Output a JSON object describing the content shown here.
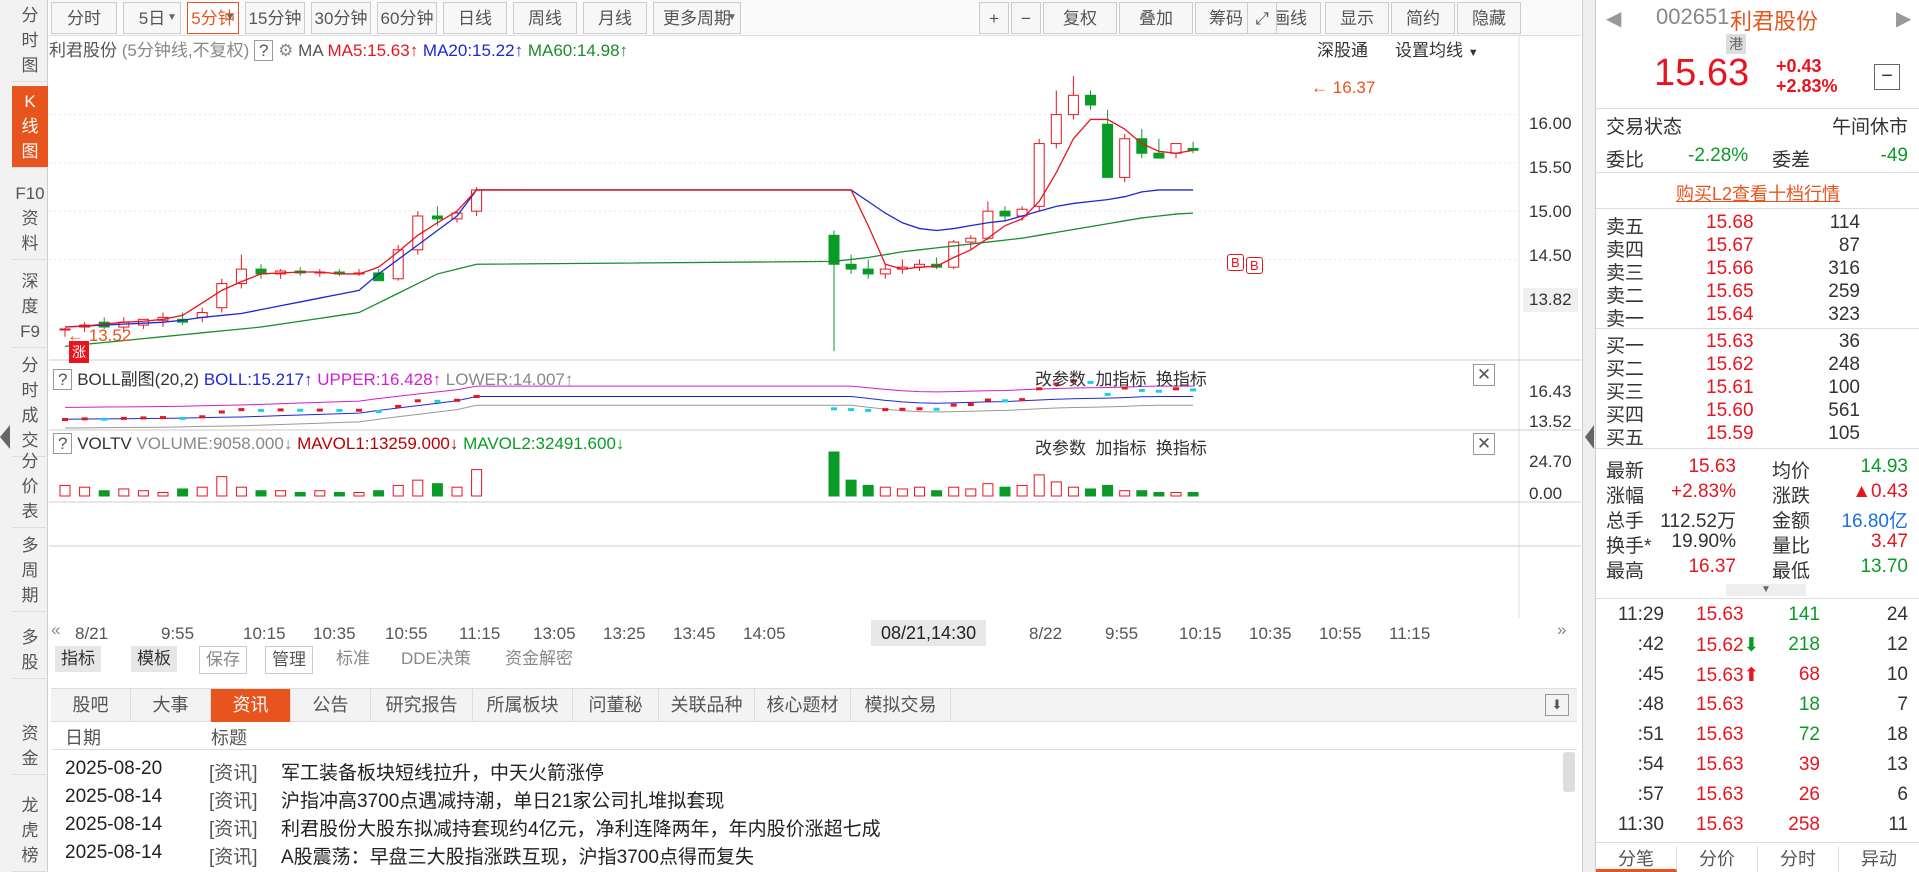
{
  "left_nav": [
    {
      "label": "分\n时\n图",
      "active": false
    },
    {
      "label": "K\n线\n图",
      "active": true
    },
    {
      "label": "F10\n资\n料",
      "active": false
    },
    {
      "label": "深\n度\nF9",
      "active": false
    },
    {
      "label": "分\n时\n成\n交",
      "active": false
    },
    {
      "label": "分\n价\n表",
      "active": false
    },
    {
      "label": "多\n周\n期",
      "active": false
    },
    {
      "label": "多\n股",
      "active": false
    },
    {
      "label": "资\n金",
      "active": false
    },
    {
      "label": "龙\n虎\n榜",
      "active": false
    }
  ],
  "toolbar": {
    "periods": [
      "分时",
      "5日",
      "5分钟",
      "15分钟",
      "30分钟",
      "60分钟",
      "日线",
      "周线",
      "月线",
      "更多周期"
    ],
    "active_period": "5分钟",
    "tools": [
      "+",
      "−",
      "复权",
      "叠加",
      "筹码",
      "画线",
      "显示",
      "简约",
      "隐藏"
    ]
  },
  "main_chart": {
    "name": "利君股份",
    "period_note": "(5分钟线,不复权)",
    "help": "?",
    "ma_label": "MA",
    "ma5": "MA5:15.63",
    "ma20": "MA20:15.22",
    "ma60": "MA60:14.98",
    "link1": "深股通",
    "link2": "设置均线",
    "high_label": "16.37",
    "low_label": "13.52",
    "limit_badge": "涨",
    "y_labels": [
      "16.00",
      "15.50",
      "15.00",
      "14.50"
    ],
    "cur_price": "13.82"
  },
  "boll": {
    "help": "?",
    "name": "BOLL副图(20,2)",
    "boll": "BOLL:15.217",
    "upper": "UPPER:16.428",
    "lower": "LOWER:14.007",
    "y_top": "16.43",
    "y_bot": "13.52",
    "btns": [
      "改参数",
      "加指标",
      "换指标"
    ]
  },
  "vol": {
    "help": "?",
    "name": "VOLTV",
    "volume": "VOLUME:9058.000",
    "mavol1": "MAVOL1:13259.000",
    "mavol2": "MAVOL2:32491.600",
    "y_top": "24.70",
    "y_bot": "0.00",
    "btns": [
      "改参数",
      "加指标",
      "换指标"
    ]
  },
  "x_axis": [
    "8/21",
    "9:55",
    "10:15",
    "10:35",
    "10:55",
    "11:15",
    "13:05",
    "13:25",
    "13:45",
    "14:05",
    "",
    "8/22",
    "9:55",
    "10:15",
    "10:35",
    "10:55",
    "11:15"
  ],
  "cursor_time": "08/21,14:30",
  "tool2": [
    "指标",
    "模板",
    "保存",
    "管理",
    "标准",
    "DDE决策",
    "资金解密"
  ],
  "bottom_tabs": [
    "股吧",
    "大事",
    "资讯",
    "公告",
    "研究报告",
    "所属板块",
    "问董秘",
    "关联品种",
    "核心题材",
    "模拟交易"
  ],
  "active_bottom_tab": "资讯",
  "news_header": {
    "date": "日期",
    "title": "标题"
  },
  "news": [
    {
      "date": "2025-08-20",
      "tag": "[资讯]",
      "title": "军工装备板块短线拉升，中天火箭涨停"
    },
    {
      "date": "2025-08-14",
      "tag": "[资讯]",
      "title": "沪指冲高3700点遇减持潮，单日21家公司扎堆拟套现"
    },
    {
      "date": "2025-08-14",
      "tag": "[资讯]",
      "title": "利君股份大股东拟减持套现约4亿元，净利连降两年，年内股价涨超七成"
    },
    {
      "date": "2025-08-14",
      "tag": "[资讯]",
      "title": "A股震荡：早盘三大股指涨跌互现，沪指3700点得而复失"
    }
  ],
  "quote": {
    "code": "002651",
    "name": "利君股份",
    "hk_badge": "港",
    "price": "15.63",
    "change": "+0.43",
    "pct": "+2.83%",
    "trade_status_label": "交易状态",
    "trade_status": "午间休市",
    "wb_label": "委比",
    "wb": "-2.28%",
    "wc_label": "委差",
    "wc": "-49",
    "l2_link": "购买L2查看十档行情",
    "sells": [
      {
        "l": "卖五",
        "p": "15.68",
        "v": "114"
      },
      {
        "l": "卖四",
        "p": "15.67",
        "v": "87"
      },
      {
        "l": "卖三",
        "p": "15.66",
        "v": "316"
      },
      {
        "l": "卖二",
        "p": "15.65",
        "v": "259"
      },
      {
        "l": "卖一",
        "p": "15.64",
        "v": "323"
      }
    ],
    "buys": [
      {
        "l": "买一",
        "p": "15.63",
        "v": "36"
      },
      {
        "l": "买二",
        "p": "15.62",
        "v": "248"
      },
      {
        "l": "买三",
        "p": "15.61",
        "v": "100"
      },
      {
        "l": "买四",
        "p": "15.60",
        "v": "561"
      },
      {
        "l": "买五",
        "p": "15.59",
        "v": "105"
      }
    ],
    "stats": [
      {
        "l1": "最新",
        "v1": "15.63",
        "c1": "red",
        "l2": "均价",
        "v2": "14.93",
        "c2": "green"
      },
      {
        "l1": "涨幅",
        "v1": "+2.83%",
        "c1": "red",
        "l2": "涨跌",
        "v2": "▲0.43",
        "c2": "red"
      },
      {
        "l1": "总手",
        "v1": "112.52万",
        "c1": "dark",
        "l2": "金额",
        "v2": "16.80亿",
        "c2": "blue"
      },
      {
        "l1": "换手*",
        "v1": "19.90%",
        "c1": "dark",
        "l2": "量比",
        "v2": "3.47",
        "c2": "red"
      },
      {
        "l1": "最高",
        "v1": "16.37",
        "c1": "red",
        "l2": "最低",
        "v2": "13.70",
        "c2": "green"
      }
    ],
    "ticks": [
      {
        "t": "11:29",
        "p": "15.63",
        "v": "141",
        "n": "24",
        "vc": "green",
        "arrow": ""
      },
      {
        "t": ":42",
        "p": "15.62",
        "v": "218",
        "n": "12",
        "vc": "green",
        "arrow": "down"
      },
      {
        "t": ":45",
        "p": "15.63",
        "v": "68",
        "n": "10",
        "vc": "red",
        "arrow": "up"
      },
      {
        "t": ":48",
        "p": "15.63",
        "v": "18",
        "n": "7",
        "vc": "green",
        "arrow": ""
      },
      {
        "t": ":51",
        "p": "15.63",
        "v": "72",
        "n": "18",
        "vc": "green",
        "arrow": ""
      },
      {
        "t": ":54",
        "p": "15.63",
        "v": "39",
        "n": "13",
        "vc": "red",
        "arrow": ""
      },
      {
        "t": ":57",
        "p": "15.63",
        "v": "26",
        "n": "6",
        "vc": "red",
        "arrow": ""
      },
      {
        "t": "11:30",
        "p": "15.63",
        "v": "258",
        "n": "11",
        "vc": "red",
        "arrow": ""
      }
    ],
    "bottom_tabs": [
      "分笔",
      "分价",
      "分时",
      "异动"
    ]
  },
  "colors": {
    "up": "#e8141e",
    "down": "#0a9b27",
    "accent": "#e8541e",
    "ma5": "#e8141e",
    "ma20": "#1e28d2",
    "ma60": "#1a8c2a"
  },
  "chart_data": {
    "type": "candlestick",
    "price_range": [
      13.5,
      16.4
    ],
    "candles": [
      [
        13.78,
        13.79,
        13.7,
        13.78
      ],
      [
        13.8,
        13.85,
        13.75,
        13.82
      ],
      [
        13.85,
        13.9,
        13.78,
        13.8
      ],
      [
        13.8,
        13.9,
        13.75,
        13.85
      ],
      [
        13.82,
        13.88,
        13.78,
        13.88
      ],
      [
        13.87,
        13.95,
        13.8,
        13.9
      ],
      [
        13.88,
        13.95,
        13.82,
        13.85
      ],
      [
        13.9,
        14.0,
        13.85,
        13.95
      ],
      [
        14.0,
        14.3,
        13.95,
        14.25
      ],
      [
        14.25,
        14.55,
        14.2,
        14.4
      ],
      [
        14.4,
        14.45,
        14.3,
        14.35
      ],
      [
        14.35,
        14.4,
        14.3,
        14.38
      ],
      [
        14.38,
        14.42,
        14.33,
        14.36
      ],
      [
        14.36,
        14.4,
        14.32,
        14.37
      ],
      [
        14.37,
        14.4,
        14.33,
        14.35
      ],
      [
        14.35,
        14.4,
        14.33,
        14.36
      ],
      [
        14.36,
        14.4,
        14.3,
        14.28
      ],
      [
        14.3,
        14.65,
        14.28,
        14.6
      ],
      [
        14.6,
        15.0,
        14.55,
        14.95
      ],
      [
        14.95,
        15.05,
        14.85,
        14.92
      ],
      [
        14.92,
        15.0,
        14.88,
        14.98
      ],
      [
        15.0,
        15.25,
        14.95,
        15.22
      ],
      [
        14.75,
        14.8,
        13.55,
        14.45
      ],
      [
        14.45,
        14.55,
        14.35,
        14.4
      ],
      [
        14.4,
        14.5,
        14.3,
        14.35
      ],
      [
        14.35,
        14.45,
        14.3,
        14.4
      ],
      [
        14.4,
        14.5,
        14.35,
        14.42
      ],
      [
        14.42,
        14.5,
        14.38,
        14.45
      ],
      [
        14.45,
        14.52,
        14.4,
        14.42
      ],
      [
        14.42,
        14.7,
        14.4,
        14.68
      ],
      [
        14.68,
        14.75,
        14.6,
        14.72
      ],
      [
        14.72,
        15.1,
        14.7,
        15.0
      ],
      [
        15.0,
        15.05,
        14.9,
        14.95
      ],
      [
        14.95,
        15.05,
        14.9,
        15.02
      ],
      [
        15.05,
        15.75,
        15.0,
        15.7
      ],
      [
        15.7,
        16.25,
        15.65,
        16.0
      ],
      [
        16.0,
        16.4,
        15.95,
        16.2
      ],
      [
        16.2,
        16.25,
        16.05,
        16.1
      ],
      [
        15.9,
        16.05,
        15.4,
        15.35
      ],
      [
        15.35,
        15.8,
        15.3,
        15.75
      ],
      [
        15.75,
        15.85,
        15.55,
        15.6
      ],
      [
        15.6,
        15.75,
        15.55,
        15.55
      ],
      [
        15.6,
        15.7,
        15.55,
        15.7
      ],
      [
        15.65,
        15.72,
        15.6,
        15.63
      ]
    ],
    "ma5": [
      13.8,
      13.81,
      13.83,
      13.85,
      13.86,
      13.88,
      13.92,
      14.05,
      14.18,
      14.27,
      14.35,
      14.36,
      14.37,
      14.37,
      14.35,
      14.35,
      14.42,
      14.58,
      14.75,
      14.88,
      15.0,
      15.22,
      15.22,
      15.22,
      14.85,
      14.45,
      14.4,
      14.42,
      14.43,
      14.52,
      14.6,
      14.72,
      14.85,
      14.92,
      15.1,
      15.4,
      15.75,
      15.95,
      15.95,
      15.85,
      15.7,
      15.62,
      15.6,
      15.63
    ],
    "ma20": [
      13.8,
      13.81,
      13.82,
      13.83,
      13.84,
      13.85,
      13.87,
      13.9,
      13.92,
      13.94,
      13.98,
      14.02,
      14.06,
      14.1,
      14.14,
      14.18,
      14.35,
      14.5,
      14.65,
      14.8,
      14.95,
      15.22,
      15.22,
      15.22,
      15.1,
      14.98,
      14.88,
      14.82,
      14.8,
      14.82,
      14.85,
      14.88,
      14.9,
      14.95,
      15.0,
      15.05,
      15.08,
      15.1,
      15.12,
      15.15,
      15.2,
      15.22,
      15.22,
      15.22
    ],
    "ma60": [
      13.6,
      13.62,
      13.64,
      13.66,
      13.68,
      13.7,
      13.72,
      13.74,
      13.76,
      13.78,
      13.8,
      13.83,
      13.86,
      13.89,
      13.92,
      13.95,
      14.05,
      14.15,
      14.25,
      14.35,
      14.4,
      14.45,
      14.48,
      14.5,
      14.52,
      14.55,
      14.58,
      14.6,
      14.62,
      14.64,
      14.66,
      14.68,
      14.7,
      14.72,
      14.75,
      14.78,
      14.81,
      14.84,
      14.87,
      14.9,
      14.93,
      14.95,
      14.97,
      14.98
    ],
    "volume": [
      6,
      5,
      3,
      4,
      3,
      2,
      4,
      5,
      11,
      5,
      3,
      3,
      2,
      3,
      2,
      2,
      3,
      6,
      9,
      7,
      5,
      15,
      25,
      9,
      6,
      5,
      4,
      5,
      3,
      5,
      4,
      7,
      5,
      6,
      12,
      8,
      5,
      4,
      6,
      3,
      3,
      2,
      2,
      2
    ]
  }
}
